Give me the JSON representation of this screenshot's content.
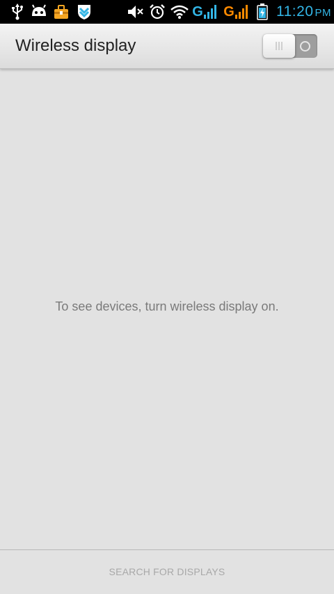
{
  "status_bar": {
    "left_icons": [
      "usb-icon",
      "android-debug-icon",
      "toolbox-icon",
      "shield-download-icon"
    ],
    "right_icons": [
      "mute-icon",
      "alarm-icon",
      "wifi-icon",
      "signal-g-icon",
      "signal-g-icon",
      "battery-charging-icon"
    ],
    "network_1": "G",
    "network_2": "G",
    "time": "11:20",
    "ampm": "PM",
    "colors": {
      "wifi_signal_1": "#33b5e5",
      "signal_2": "#ff8a00",
      "battery": "#33b5e5"
    }
  },
  "action_bar": {
    "title": "Wireless display",
    "toggle_state": "off"
  },
  "main": {
    "empty_message": "To see devices, turn wireless display on."
  },
  "bottom": {
    "search_button_label": "SEARCH FOR DISPLAYS"
  }
}
